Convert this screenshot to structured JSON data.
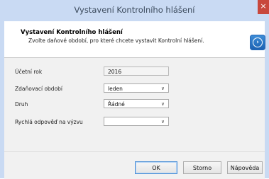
{
  "window": {
    "title": "Vystavení Kontrolního hlášení",
    "close_label": "×"
  },
  "header": {
    "title": "Vystavení Kontrolního hlášení",
    "subtitle": "Zvolte daňové období, pro které chcete vystavit Kontrolní hlášení.",
    "icon": "wizard-arrow-icon"
  },
  "form": {
    "year_label": "Účetní rok",
    "year_value": "2016",
    "period_label": "Zdaňovací období",
    "period_value": "leden",
    "type_label": "Druh",
    "type_value": "Řádné",
    "response_label": "Rychlá odpověď na výzvu",
    "response_value": ""
  },
  "buttons": {
    "ok": "OK",
    "cancel": "Storno",
    "help": "Nápověda"
  }
}
